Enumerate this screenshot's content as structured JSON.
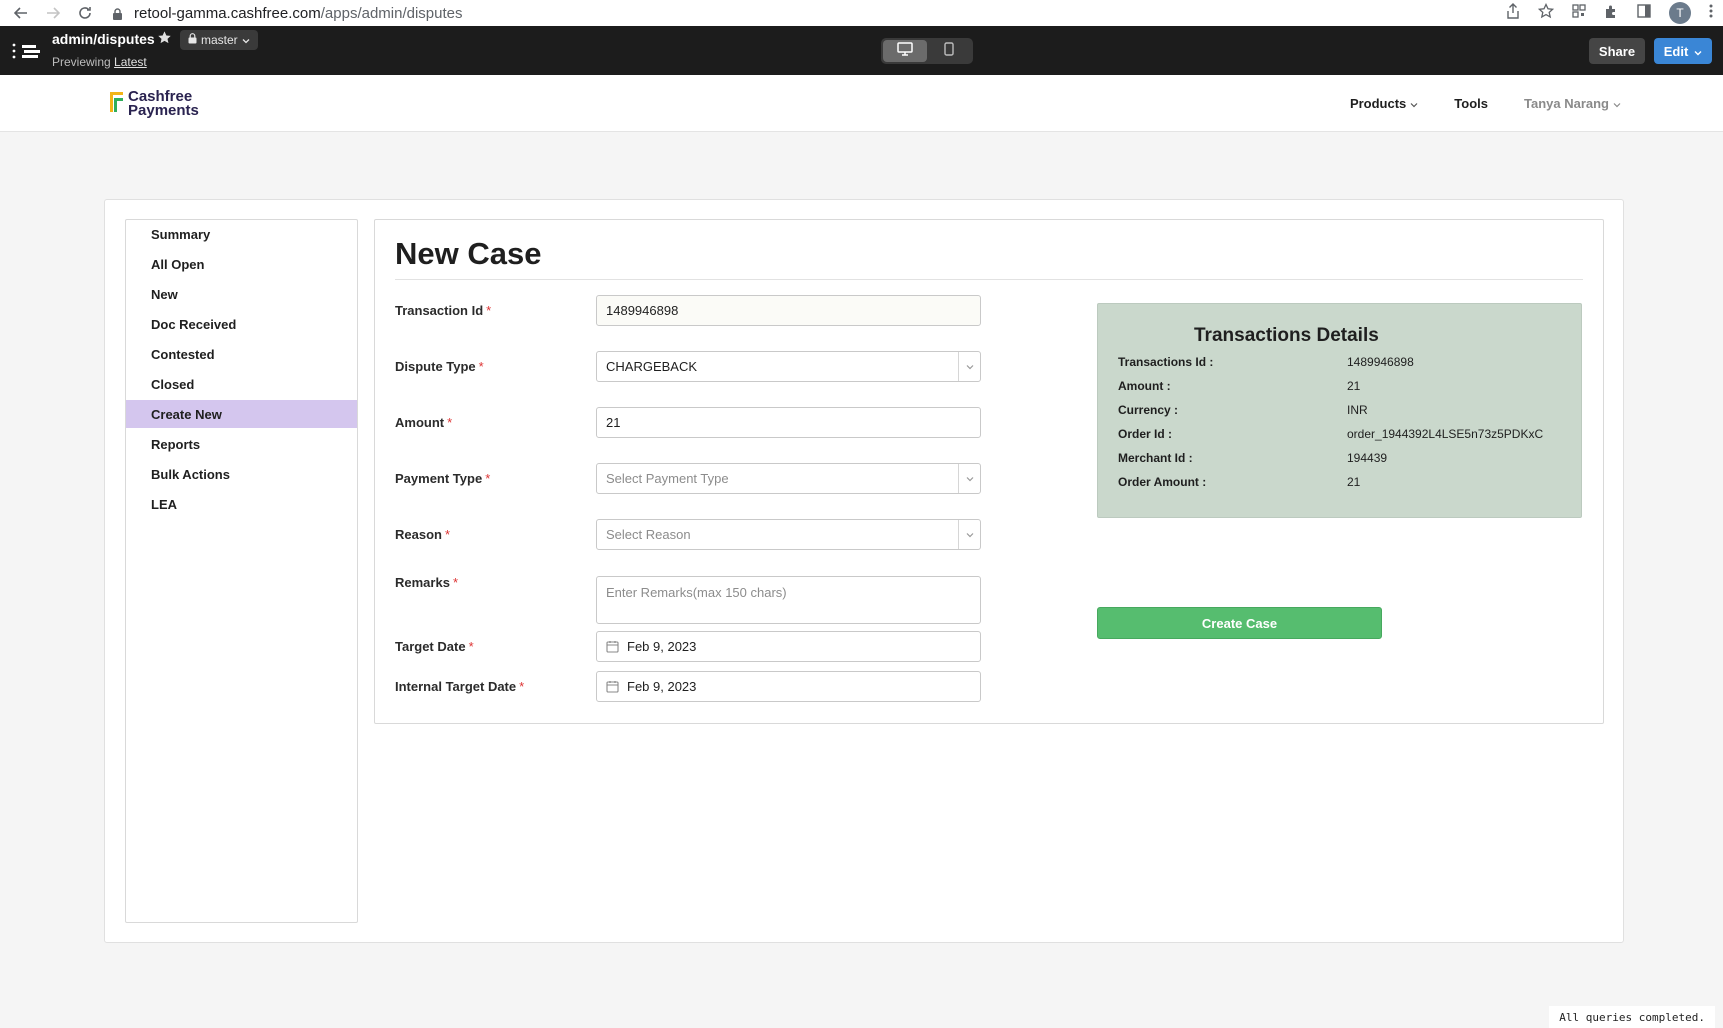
{
  "browser": {
    "url_host": "retool-gamma.cashfree.com",
    "url_path": "/apps/admin/disputes",
    "profile_initial": "T"
  },
  "retool": {
    "app_title": "admin/disputes",
    "branch": "master",
    "preview_prefix": "Previewing",
    "preview_link": "Latest",
    "share_label": "Share",
    "edit_label": "Edit"
  },
  "nav": {
    "logo_line1": "Cashfree",
    "logo_line2": "Payments",
    "products": "Products",
    "tools": "Tools",
    "user": "Tanya Narang"
  },
  "sidebar": {
    "items": [
      {
        "label": "Summary"
      },
      {
        "label": "All Open"
      },
      {
        "label": "New"
      },
      {
        "label": "Doc Received"
      },
      {
        "label": "Contested"
      },
      {
        "label": "Closed"
      },
      {
        "label": "Create New",
        "active": true
      },
      {
        "label": "Reports"
      },
      {
        "label": "Bulk Actions"
      },
      {
        "label": "LEA"
      }
    ]
  },
  "form": {
    "title": "New Case",
    "required_mark": "*",
    "transaction_id": {
      "label": "Transaction Id",
      "value": "1489946898"
    },
    "dispute_type": {
      "label": "Dispute Type",
      "value": "CHARGEBACK"
    },
    "amount": {
      "label": "Amount",
      "value": "21"
    },
    "payment_type": {
      "label": "Payment Type",
      "placeholder": "Select Payment Type"
    },
    "reason": {
      "label": "Reason",
      "placeholder": "Select Reason"
    },
    "remarks": {
      "label": "Remarks",
      "placeholder": "Enter Remarks(max 150 chars)"
    },
    "target_date": {
      "label": "Target Date",
      "value": "Feb 9, 2023"
    },
    "internal_target_date": {
      "label": "Internal Target Date",
      "value": "Feb 9, 2023"
    }
  },
  "transaction_details": {
    "title": "Transactions Details",
    "rows": [
      {
        "key": "Transactions Id :",
        "value": "1489946898"
      },
      {
        "key": "Amount :",
        "value": "21"
      },
      {
        "key": "Currency :",
        "value": "INR"
      },
      {
        "key": "Order Id :",
        "value": "order_1944392L4LSE5n73z5PDKxC"
      },
      {
        "key": "Merchant Id :",
        "value": "194439"
      },
      {
        "key": "Order Amount :",
        "value": "21"
      }
    ]
  },
  "actions": {
    "create_case": "Create Case"
  },
  "status": {
    "text": "All queries completed."
  },
  "colors": {
    "accent_purple": "#d4c6ee",
    "success_green": "#56bd6f",
    "details_bg": "#cad8cc",
    "retool_dark": "#1c1c1c",
    "edit_blue": "#3a86d6"
  }
}
